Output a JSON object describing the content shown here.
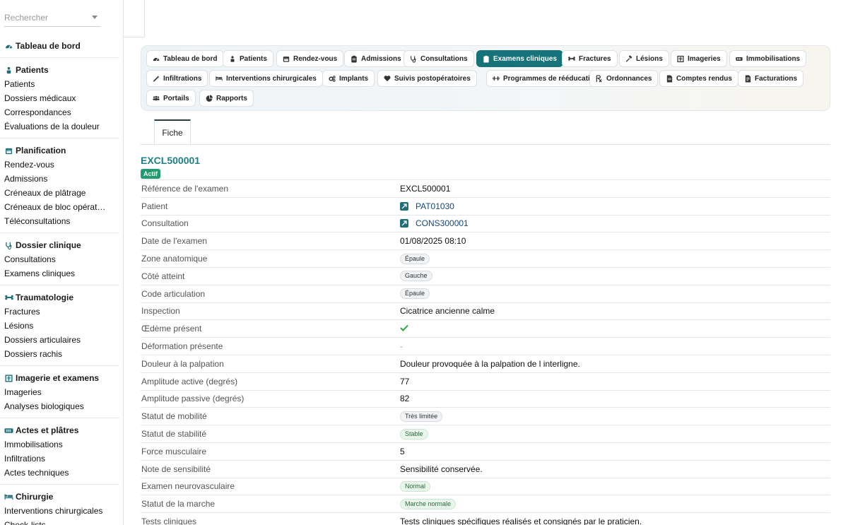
{
  "search": {
    "placeholder": "Rechercher"
  },
  "sidebar": {
    "sections": [
      {
        "title": "Tableau de bord",
        "icon": "dashboard-icon",
        "items": []
      },
      {
        "title": "Patients",
        "icon": "patients-icon",
        "items": [
          "Patients",
          "Dossiers médicaux",
          "Correspondances",
          "Évaluations de la douleur"
        ]
      },
      {
        "title": "Planification",
        "icon": "calendar-icon",
        "items": [
          "Rendez-vous",
          "Admissions",
          "Créneaux de plâtrage",
          "Créneaux de bloc opérat…",
          "Téléconsultations"
        ]
      },
      {
        "title": "Dossier clinique",
        "icon": "stethoscope-icon",
        "items": [
          "Consultations",
          "Examens cliniques"
        ]
      },
      {
        "title": "Traumatologie",
        "icon": "bone-icon",
        "items": [
          "Fractures",
          "Lésions",
          "Dossiers articulaires",
          "Dossiers rachis"
        ]
      },
      {
        "title": "Imagerie et examens",
        "icon": "xray-icon",
        "items": [
          "Imageries",
          "Analyses biologiques"
        ]
      },
      {
        "title": "Actes et plâtres",
        "icon": "bandage-icon",
        "items": [
          "Immobilisations",
          "Infiltrations",
          "Actes techniques"
        ]
      },
      {
        "title": "Chirurgie",
        "icon": "surgery-bed-icon",
        "items": [
          "Interventions chirurgicales",
          "Check-lists"
        ]
      }
    ]
  },
  "tabs": {
    "row1": [
      {
        "label": "Tableau de bord",
        "icon": "dashboard-icon"
      },
      {
        "label": "Patients",
        "icon": "patients-icon"
      },
      {
        "label": "Rendez-vous",
        "icon": "calendar-icon"
      },
      {
        "label": "Admissions",
        "icon": "clipboard-icon"
      },
      {
        "label": "Consultations",
        "icon": "stethoscope-icon"
      },
      {
        "label": "Examens cliniques",
        "icon": "clipboard-icon",
        "active": true
      },
      {
        "label": "Fractures",
        "icon": "bone-icon"
      },
      {
        "label": "Lésions",
        "icon": "hammer-icon"
      },
      {
        "label": "Imageries",
        "icon": "xray-icon"
      },
      {
        "label": "Immobilisations",
        "icon": "bandage-icon"
      }
    ],
    "row2": [
      {
        "label": "Infiltrations",
        "icon": "syringe-icon"
      },
      {
        "label": "Interventions chirurgicales",
        "icon": "surgery-bed-icon"
      },
      {
        "label": "Implants",
        "icon": "gears-icon"
      },
      {
        "label": "Suivis postopératoires",
        "icon": "heart-icon"
      },
      {
        "label": "Programmes de rééducation",
        "icon": "dumbbell-icon"
      },
      {
        "label": "Ordonnances",
        "icon": "prescription-icon"
      },
      {
        "label": "Comptes rendus",
        "icon": "file-icon"
      },
      {
        "label": "Facturations",
        "icon": "invoice-icon"
      }
    ],
    "row3": [
      {
        "label": "Portails",
        "icon": "users-icon"
      },
      {
        "label": "Rapports",
        "icon": "pie-chart-icon"
      }
    ]
  },
  "detail_tab": "Fiche",
  "record": {
    "title": "EXCL500001",
    "status": "Actif",
    "accent_color": "#1f7f86",
    "status_color": "#1f9c6f",
    "rows": [
      {
        "label": "Référence de l'examen",
        "value": "EXCL500001",
        "type": "text"
      },
      {
        "label": "Patient",
        "value": "PAT01030",
        "type": "link"
      },
      {
        "label": "Consultation",
        "value": "CONS300001",
        "type": "link"
      },
      {
        "label": "Date de l'examen",
        "value": "01/08/2025 08:10",
        "type": "text"
      },
      {
        "label": "Zone anatomique",
        "value": "Épaule",
        "type": "pill"
      },
      {
        "label": "Côté atteint",
        "value": "Gauche",
        "type": "pill"
      },
      {
        "label": "Code articulation",
        "value": "Épaule",
        "type": "pill"
      },
      {
        "label": "Inspection",
        "value": "Cicatrice ancienne calme",
        "type": "text"
      },
      {
        "label": "Œdème présent",
        "value": "",
        "type": "check"
      },
      {
        "label": "Déformation présente",
        "value": "-",
        "type": "dash"
      },
      {
        "label": "Douleur à la palpation",
        "value": "Douleur provoquée à la palpation de l interligne.",
        "type": "text"
      },
      {
        "label": "Amplitude active (degrés)",
        "value": "77",
        "type": "text"
      },
      {
        "label": "Amplitude passive (degrés)",
        "value": "82",
        "type": "text"
      },
      {
        "label": "Statut de mobilité",
        "value": "Très limitée",
        "type": "pill"
      },
      {
        "label": "Statut de stabilité",
        "value": "Stable",
        "type": "pill-green"
      },
      {
        "label": "Force musculaire",
        "value": "5",
        "type": "text"
      },
      {
        "label": "Note de sensibilité",
        "value": "Sensibilité conservée.",
        "type": "text"
      },
      {
        "label": "Examen neurovasculaire",
        "value": "Normal",
        "type": "pill-green"
      },
      {
        "label": "Statut de la marche",
        "value": "Marche normale",
        "type": "pill-green"
      },
      {
        "label": "Tests cliniques",
        "value": "Tests cliniques spécifiques réalisés et consignés par le praticien.",
        "type": "text"
      }
    ]
  }
}
